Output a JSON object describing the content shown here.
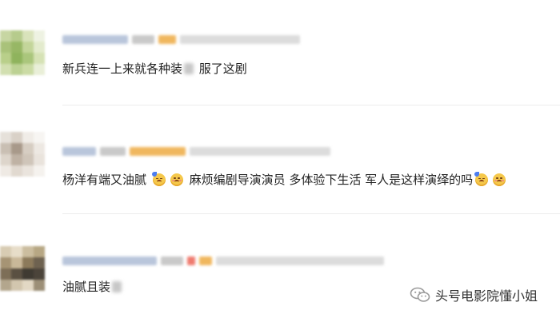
{
  "comments": [
    {
      "text_before": "新兵连一上来就各种装",
      "text_after": " 服了这剧",
      "avatar_palette": [
        "#c9d8a6",
        "#a8c27a",
        "#d9e4bd",
        "#8fb35d"
      ]
    },
    {
      "text_1": "杨洋有端又油腻",
      "text_2": " 麻烦编剧导演演员 多体验下生活 军人是这样演绎的吗",
      "emoji_1": "sweat-face-icon",
      "emoji_2": "sad-face-icon",
      "avatar_palette": [
        "#e3ddd5",
        "#cfc6bc",
        "#b9ada0",
        "#f0ece7"
      ]
    },
    {
      "text_before": "油腻且装",
      "avatar_palette": [
        "#6e6250",
        "#c7b89a",
        "#3f3a32",
        "#e2d8c4"
      ]
    }
  ],
  "watermark": {
    "text": "头号电影院懂小姐",
    "icon": "wechat-icon"
  }
}
